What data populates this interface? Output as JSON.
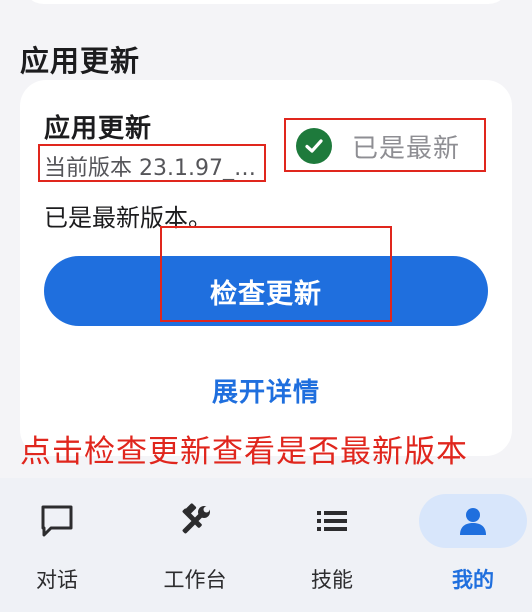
{
  "section": {
    "title": "应用更新"
  },
  "card": {
    "title": "应用更新",
    "version": "当前版本 23.1.97_p...",
    "status_label": "已是最新",
    "latest_text": "已是最新版本。",
    "check_button_label": "检查更新",
    "expand_label": "展开详情"
  },
  "annotation": {
    "text": "点击检查更新查看是否最新版本"
  },
  "nav": {
    "items": [
      {
        "label": "对话",
        "icon": "chat-bubble-icon"
      },
      {
        "label": "工作台",
        "icon": "tools-icon"
      },
      {
        "label": "技能",
        "icon": "list-icon"
      },
      {
        "label": "我的",
        "icon": "person-icon",
        "active": true
      }
    ]
  },
  "colors": {
    "accent": "#1f6fde",
    "success": "#1e7a3c",
    "annotation_red": "#e0261d",
    "background": "#f4f4f7",
    "nav_active_pill": "#d8e6fb"
  }
}
